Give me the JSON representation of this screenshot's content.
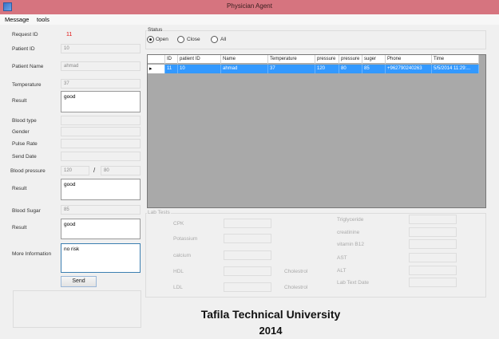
{
  "window": {
    "title": "Physician Agent"
  },
  "menu": {
    "items": [
      "Message",
      "tools"
    ]
  },
  "form": {
    "request_id": {
      "label": "Request ID",
      "value": "11"
    },
    "patient_id": {
      "label": "Patient ID",
      "value": "10"
    },
    "patient_name": {
      "label": "Patient Name",
      "value": "ahmad"
    },
    "temperature": {
      "label": "Temperature",
      "value": "37"
    },
    "result1": {
      "label": "Result",
      "value": "good"
    },
    "blood_type": {
      "label": "Blood type",
      "value": ""
    },
    "gender": {
      "label": "Gender",
      "value": ""
    },
    "pulse_rate": {
      "label": "Pulse Rate",
      "value": ""
    },
    "send_date": {
      "label": "Send Date",
      "value": ""
    },
    "blood_pressure": {
      "label": "Blood pressure",
      "value1": "120",
      "separator": "/",
      "value2": "80"
    },
    "result2": {
      "label": "Result",
      "value": "good"
    },
    "blood_sugar": {
      "label": "Blood Sugar",
      "value": "85"
    },
    "result3": {
      "label": "Result",
      "value": "good"
    },
    "more_info": {
      "label": "More Information",
      "value": "no risk"
    },
    "send_label": "Send"
  },
  "status": {
    "title": "Status",
    "options": [
      "Open",
      "Close",
      "All"
    ],
    "selected": "Open"
  },
  "table": {
    "columns": [
      "",
      "ID",
      "patient ID",
      "Name",
      "Temperature",
      "pressure",
      "pressure",
      "suger",
      "Phone",
      "Time"
    ],
    "rows": [
      {
        "marker": "▸",
        "cells": [
          "11",
          "10",
          "ahmad",
          "37",
          "120",
          "80",
          "85",
          "+962790240263",
          "5/5/2014 11:29:..."
        ]
      }
    ]
  },
  "lab_tests": {
    "title": "Lab Tests",
    "col1": [
      "CPK",
      "Potassium",
      "calcium",
      "HDL",
      "LDL"
    ],
    "col2": [
      "",
      "",
      "",
      "Cholestrol",
      "Cholestrol"
    ],
    "col3": [
      "Triglyceride",
      "creatinine",
      "vitamin B12",
      "AST",
      "ALT",
      "Lab Text Date"
    ]
  },
  "footer": {
    "university": "Tafila Technical University",
    "year": "2014"
  },
  "colors": {
    "titlebar": "#d6747f",
    "selection": "#3399ff",
    "request_id": "#e01010"
  }
}
